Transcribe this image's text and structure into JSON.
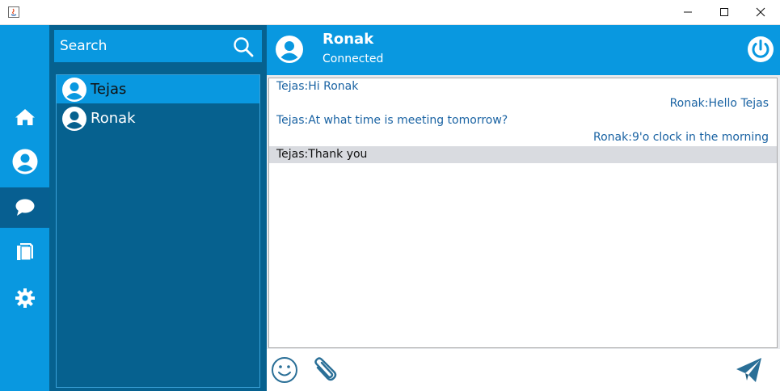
{
  "window": {
    "minimize_icon": "minimize-icon",
    "maximize_icon": "maximize-icon",
    "close_icon": "close-icon"
  },
  "nav": {
    "items": [
      {
        "icon": "home-icon"
      },
      {
        "icon": "profile-icon"
      },
      {
        "icon": "chat-icon",
        "active": true
      },
      {
        "icon": "files-icon"
      },
      {
        "icon": "settings-icon"
      }
    ]
  },
  "search": {
    "placeholder": "Search",
    "value": "Search",
    "icon": "search-icon"
  },
  "contacts": [
    {
      "name": "Tejas",
      "selected": true
    },
    {
      "name": "Ronak",
      "selected": false
    }
  ],
  "chat": {
    "name": "Ronak",
    "status": "Connected",
    "messages": [
      {
        "text": "Tejas:Hi Ronak",
        "align": "left"
      },
      {
        "text": "Ronak:Hello Tejas",
        "align": "right"
      },
      {
        "text": "Tejas:At what time is meeting tomorrow?",
        "align": "left"
      },
      {
        "text": "Ronak:9'o clock in the morning",
        "align": "right"
      },
      {
        "text": "Tejas:Thank you",
        "align": "left",
        "highlighted": true
      }
    ]
  },
  "colors": {
    "accent": "#0998e0",
    "panel": "#06618f",
    "message_text": "#1a63a3",
    "send_icon": "#2a6f97"
  }
}
